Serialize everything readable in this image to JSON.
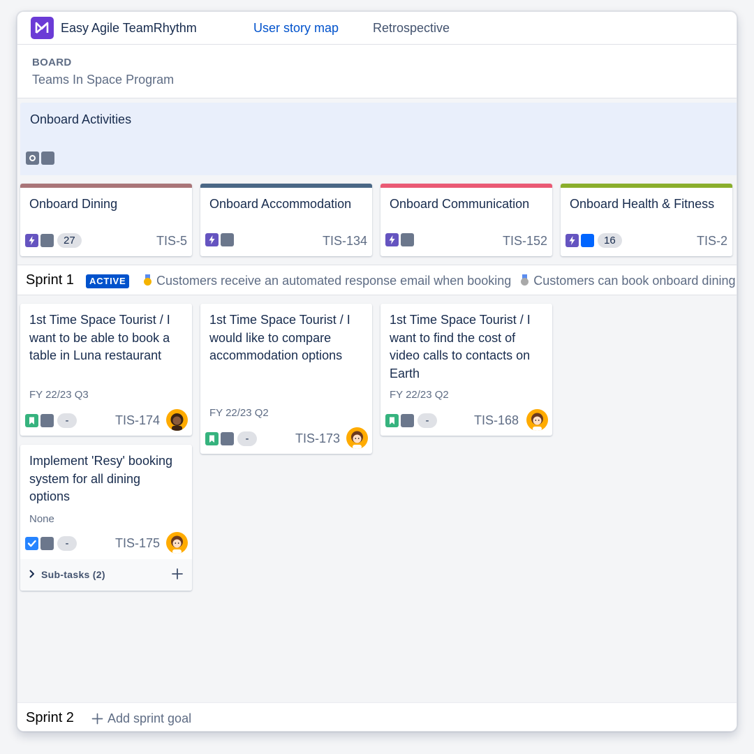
{
  "app": {
    "title": "Easy Agile TeamRhythm"
  },
  "tabs": [
    {
      "label": "User story map",
      "active": true
    },
    {
      "label": "Retrospective",
      "active": false
    }
  ],
  "board": {
    "label": "BOARD",
    "name": "Teams In Space Program"
  },
  "activity": {
    "title": "Onboard Activities"
  },
  "epics": [
    {
      "title": "Onboard Dining",
      "key": "TIS-5",
      "count": "27",
      "color": "#a97578"
    },
    {
      "title": "Onboard Accommodation",
      "key": "TIS-134",
      "color": "#4a6785"
    },
    {
      "title": "Onboard Communication",
      "key": "TIS-152",
      "color": "#ea5a74"
    },
    {
      "title": "Onboard Health & Fitness",
      "key": "TIS-2",
      "count": "16",
      "color": "#8aae2c"
    }
  ],
  "sprint1": {
    "name": "Sprint 1",
    "status": "ACTIVE",
    "goals": [
      "Customers receive an automated response email when booking",
      "Customers can book onboard dining"
    ]
  },
  "cards": [
    {
      "summary": "1st Time Space Tourist / I want to be able to book a table in Luna restaurant",
      "version": "FY 22/23 Q3",
      "points": "-",
      "key": "TIS-174"
    },
    {
      "summary": "1st Time Space Tourist / I would like to compare accommodation options",
      "version": "FY 22/23 Q2",
      "points": "-",
      "key": "TIS-173"
    },
    {
      "summary": "1st Time Space Tourist / I want to find the cost of video calls to contacts on Earth",
      "version": "FY 22/23 Q2",
      "points": "-",
      "key": "TIS-168"
    },
    {
      "summary": "Implement 'Resy' booking system for all dining options",
      "version": "None",
      "points": "-",
      "key": "TIS-175",
      "subtasks": "Sub-tasks (2)"
    }
  ],
  "sprint2": {
    "name": "Sprint 2",
    "add_goal": "Add sprint goal"
  },
  "colors": {
    "accent": "#0052cc",
    "epic_icon": "#6554c0",
    "story_icon": "#36b37e",
    "task_icon": "#2684ff",
    "avatar_bg": "#ffab00"
  }
}
